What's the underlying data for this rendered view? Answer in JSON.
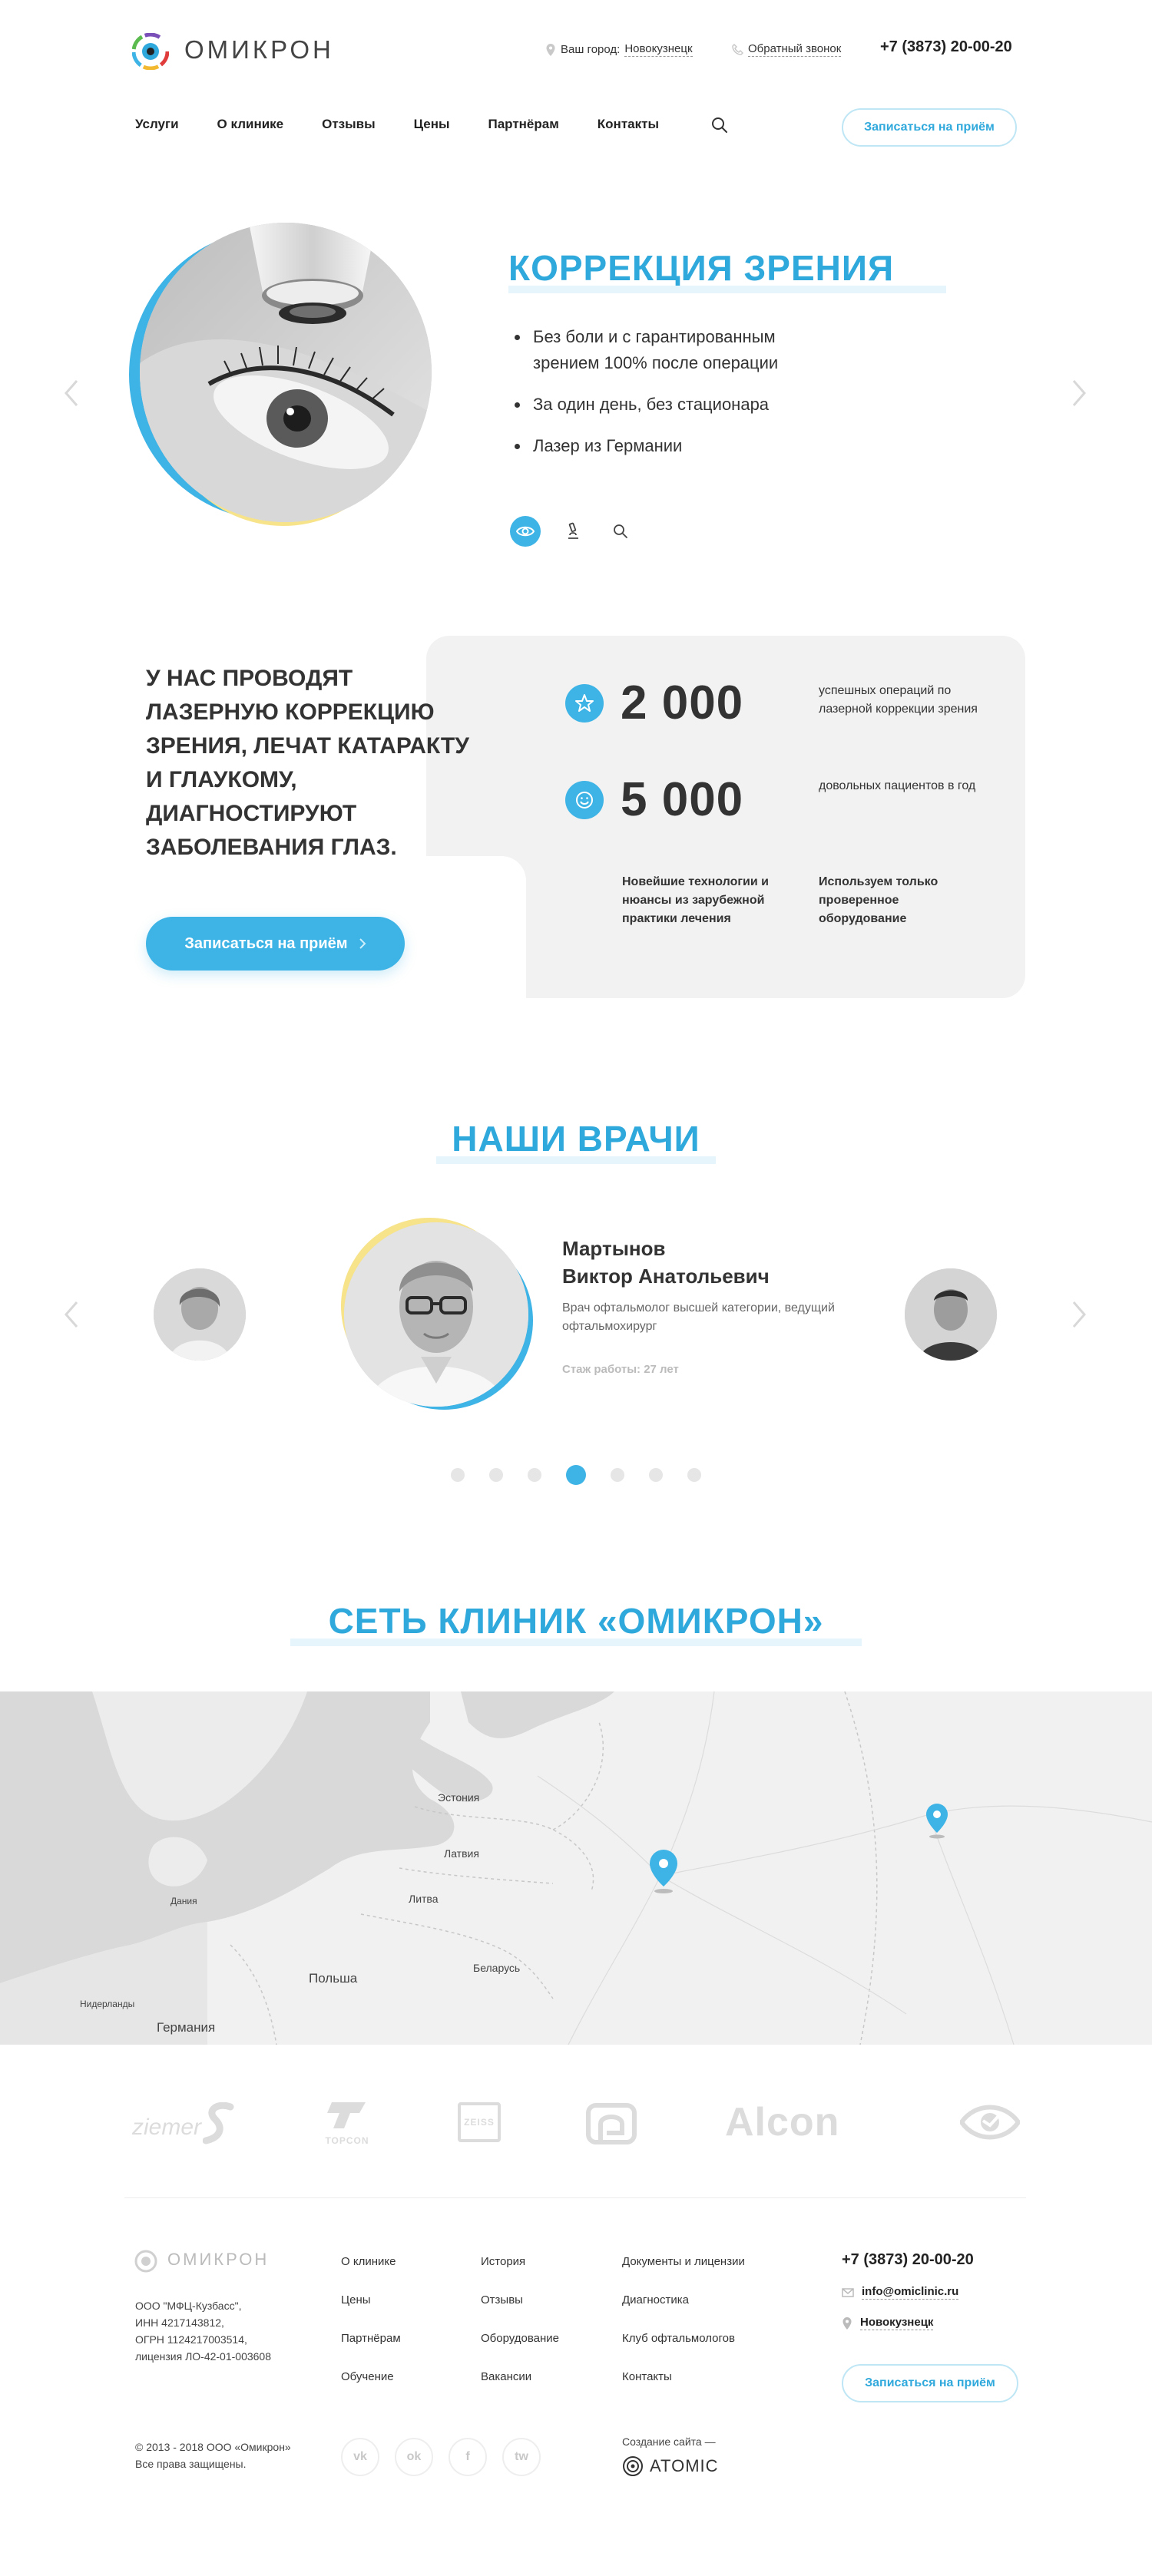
{
  "header": {
    "logo_text": "ОМИКРОН",
    "city_label": "Ваш город:",
    "city_value": "Новокузнецк",
    "callback": "Обратный звонок",
    "phone": "+7 (3873) 20-00-20",
    "nav": [
      "Услуги",
      "О клинике",
      "Отзывы",
      "Цены",
      "Партнёрам",
      "Контакты"
    ],
    "cta": "Записаться на приём"
  },
  "hero": {
    "title": "КОРРЕКЦИЯ ЗРЕНИЯ",
    "bullets": [
      "Без боли и с гарантированным зрением 100% после операции",
      "За один день, без стационара",
      "Лазер из Германии"
    ]
  },
  "about": {
    "text": "У нас проводят лазерную коррекцию зрения, лечат катаракту и глаукому, диагностируют заболевания глаз.",
    "cta": "Записаться на приём",
    "stats": [
      {
        "number": "2 000",
        "desc": "успешных операций по лазерной коррекции зрения"
      },
      {
        "number": "5 000",
        "desc": "довольных пациентов в год"
      }
    ],
    "features": [
      "Новейшие технологии и нюансы из зарубежной практики лечения",
      "Используем только проверенное оборудование"
    ]
  },
  "doctors": {
    "title": "НАШИ ВРАЧИ",
    "name_line1": "Мартынов",
    "name_line2": "Виктор Анатольевич",
    "role": "Врач офтальмолог высшей категории, ведущий офтальмохирург",
    "experience": "Стаж работы: 27 лет",
    "slide_count": 7,
    "active_slide": 4
  },
  "network": {
    "title": "СЕТЬ КЛИНИК «ОМИКРОН»",
    "map_labels": [
      "Эстония",
      "Латвия",
      "Литва",
      "Дания",
      "Польша",
      "Беларусь",
      "Нидерланды",
      "Германия"
    ]
  },
  "partners": [
    "ziemer",
    "TOPCON",
    "ZEISS",
    "Abbott",
    "Alcon",
    "eye-logo"
  ],
  "footer": {
    "logo_text": "ОМИКРОН",
    "legal": [
      "ООО \"МФЦ-Кузбасс\",",
      "ИНН 4217143812,",
      "ОГРН 1124217003514,",
      "лицензия ЛО-42-01-003608"
    ],
    "col1": [
      "О клинике",
      "Цены",
      "Партнёрам",
      "Обучение"
    ],
    "col2": [
      "История",
      "Отзывы",
      "Оборудование",
      "Вакансии"
    ],
    "col3": [
      "Документы и лицензии",
      "Диагностика",
      "Клуб офтальмологов",
      "Контакты"
    ],
    "phone": "+7 (3873) 20-00-20",
    "email": "info@omiclinic.ru",
    "city": "Новокузнецк",
    "cta": "Записаться на приём",
    "copyright_1": "© 2013 - 2018 ООО «Омикрон»",
    "copyright_2": "Все права защищены.",
    "socials": [
      "vk",
      "ok",
      "f",
      "tw"
    ],
    "created_by": "Создание сайта —",
    "studio": "ATOMIC"
  },
  "colors": {
    "accent": "#3eb3e5",
    "accent_text": "#2fa8dc",
    "yellow": "#f7e38a",
    "panel": "#f2f2f2"
  }
}
